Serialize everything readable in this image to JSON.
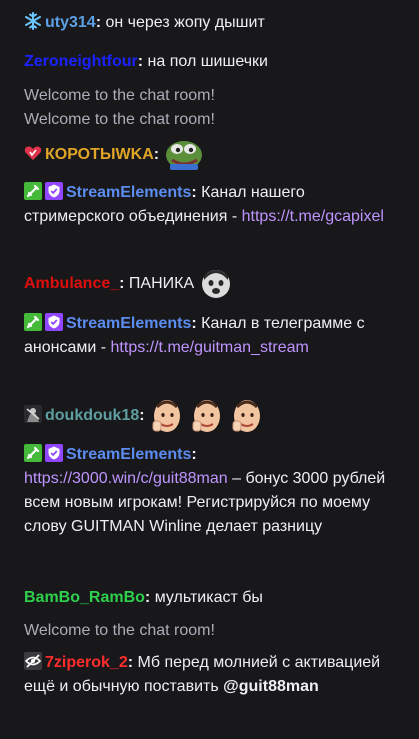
{
  "messages": [
    {
      "user": "uty314",
      "user_color": "#5ca1e6",
      "badges": [
        "snowflake-badge-icon"
      ],
      "text": "он через жопу дышит"
    },
    {
      "user": "Zeroneightfour",
      "user_color": "#1a23ff",
      "text": "на пол шишечки"
    },
    {
      "system": "Welcome to the chat room!"
    },
    {
      "system": "Welcome to the chat room!"
    },
    {
      "user": "КОРОТЫWKA",
      "user_color": "#e0a526",
      "badges": [
        "heart-badge-icon"
      ],
      "emote": "pepe-emote-icon"
    },
    {
      "user": "StreamElements",
      "user_color": "#5c8cf0",
      "badges": [
        "sword-badge-icon",
        "verified-badge-icon"
      ],
      "text": "Канал нашего стримерского объединения -",
      "link": "https://t.me/gcapixel"
    },
    {
      "user": "Ambulance_",
      "user_color": "#e00d0d",
      "text": "ПАНИКА",
      "emote": "face-emote-icon"
    },
    {
      "user": "StreamElements",
      "user_color": "#5c8cf0",
      "badges": [
        "sword-badge-icon",
        "verified-badge-icon"
      ],
      "text": "Канал в телеграмме с анонсами -",
      "link": "https://t.me/guitman_stream"
    },
    {
      "user": "doukdouk18",
      "user_color": "#5f9ea0",
      "badges": [
        "character-badge-icon"
      ],
      "emote": "hand-emote-icon"
    },
    {
      "user": "StreamElements",
      "user_color": "#5c8cf0",
      "badges": [
        "sword-badge-icon",
        "verified-badge-icon"
      ],
      "link": "https://3000.win/c/guit88man",
      "text_after": "– бонус 3000 рублей всем новым игрокам! Регистрируйся по моему слову GUITMAN Winline делает разницу"
    },
    {
      "user": "BamBo_RamBo",
      "user_color": "#2dd14b",
      "text": "мультикаст бы"
    },
    {
      "system": "Welcome to the chat room!"
    },
    {
      "user": "7ziperok_2",
      "user_color": "#ff2c2c",
      "badges": [
        "hidden-eye-badge-icon"
      ],
      "text": "Мб перед молнией с активацией ещё и обычную поставить",
      "mention": "@guit88man"
    }
  ]
}
